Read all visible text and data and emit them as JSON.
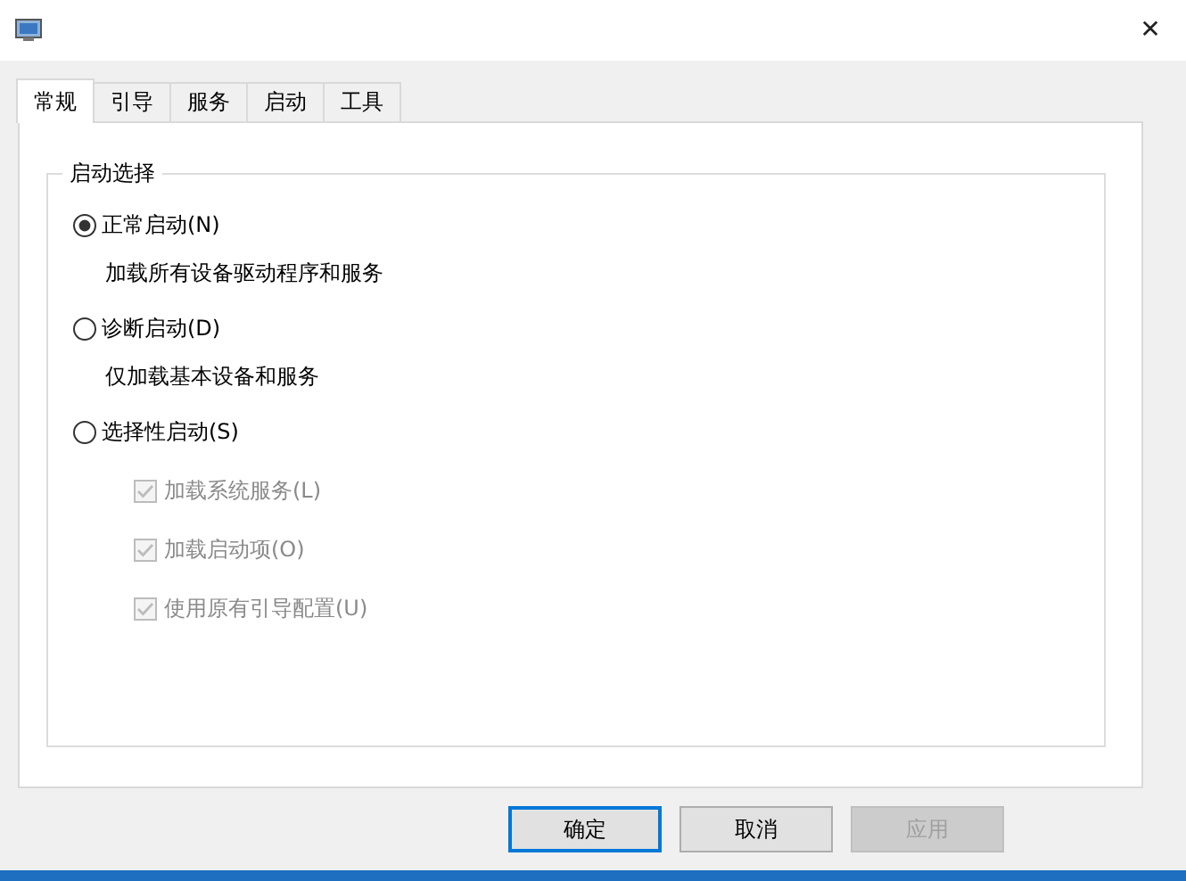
{
  "window": {
    "close": "✕"
  },
  "tabs": [
    {
      "label": "常规",
      "selected": true
    },
    {
      "label": "引导",
      "selected": false
    },
    {
      "label": "服务",
      "selected": false
    },
    {
      "label": "启动",
      "selected": false
    },
    {
      "label": "工具",
      "selected": false
    }
  ],
  "group": {
    "title": "启动选择",
    "options": [
      {
        "label": "正常启动(N)",
        "selected": true,
        "description": "加载所有设备驱动程序和服务"
      },
      {
        "label": "诊断启动(D)",
        "selected": false,
        "description": "仅加载基本设备和服务"
      },
      {
        "label": "选择性启动(S)",
        "selected": false,
        "checkboxes": [
          {
            "label": "加载系统服务(L)",
            "checked": true,
            "disabled": true
          },
          {
            "label": "加载启动项(O)",
            "checked": true,
            "disabled": true
          },
          {
            "label": "使用原有引导配置(U)",
            "checked": true,
            "disabled": true
          }
        ]
      }
    ]
  },
  "buttons": [
    {
      "label": "确定",
      "disabled": false,
      "default": true
    },
    {
      "label": "取消",
      "disabled": false,
      "default": false
    },
    {
      "label": "应用",
      "disabled": true,
      "default": false
    }
  ]
}
